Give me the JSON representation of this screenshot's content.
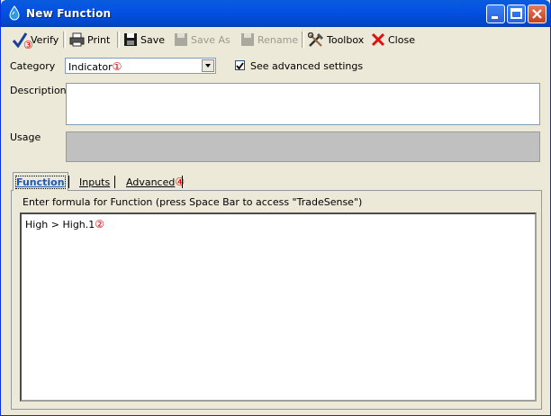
{
  "window": {
    "title": "New Function"
  },
  "toolbar": {
    "verify": {
      "label": "Verify",
      "marker": "③"
    },
    "print": {
      "label": "Print"
    },
    "save": {
      "label": "Save"
    },
    "save_as": {
      "label": "Save As"
    },
    "rename": {
      "label": "Rename"
    },
    "toolbox": {
      "label": "Toolbox"
    },
    "close": {
      "label": "Close"
    }
  },
  "form": {
    "category_label": "Category",
    "category_value": "Indicator",
    "category_marker": "①",
    "advanced_checkbox_label": "See advanced settings",
    "advanced_checked": true,
    "description_label": "Description",
    "usage_label": "Usage"
  },
  "tabs": [
    {
      "label": "Function",
      "active": true
    },
    {
      "label": "Inputs",
      "active": false
    },
    {
      "label": "Advanced",
      "active": false,
      "marker": "④"
    }
  ],
  "editor": {
    "hint": "Enter formula for Function  (press Space Bar to access \"TradeSense\")",
    "formula": "High > High.1",
    "formula_marker": "②"
  },
  "colors": {
    "titlebar": "#0054e3",
    "marker": "#e00000",
    "active_tab": "#1a5ab6"
  }
}
